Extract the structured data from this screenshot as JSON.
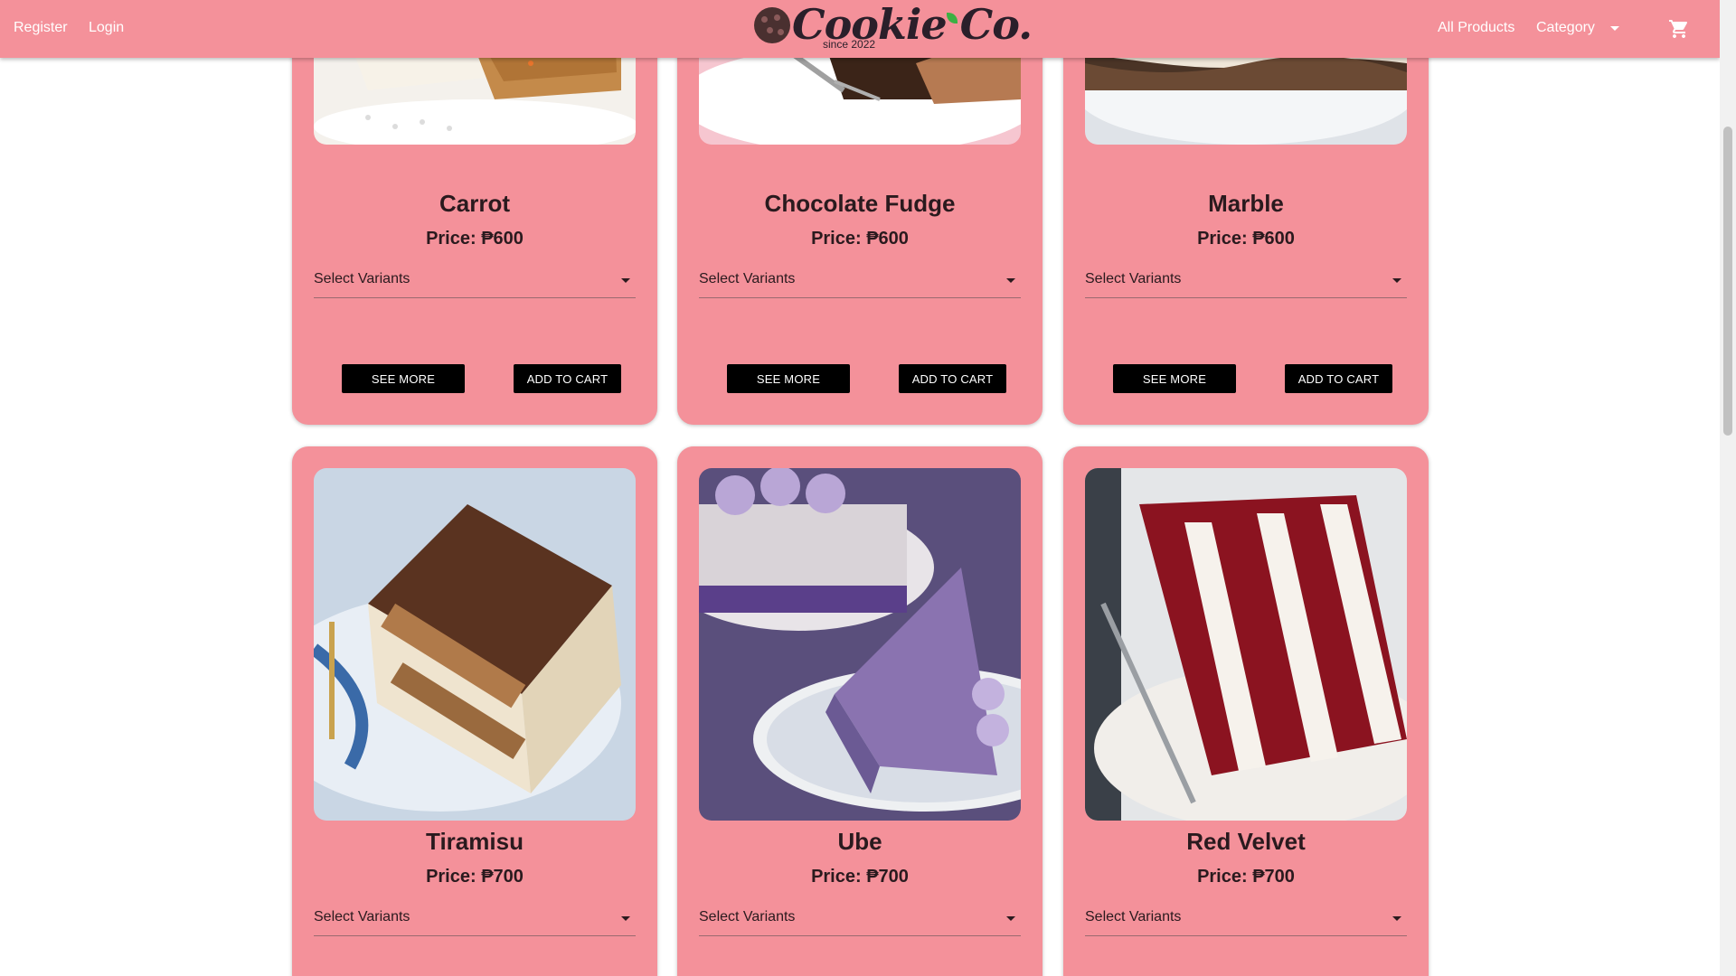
{
  "nav": {
    "register": "Register",
    "login": "Login",
    "brand_name": "Cookie Co.",
    "brand_tagline": "since 2022",
    "all_products": "All Products",
    "category": "Category",
    "cart_icon": "shopping-cart-icon"
  },
  "products": [
    {
      "name": "Carrot",
      "price": "Price: ₱600",
      "variant_placeholder": "Select Variants",
      "see_more": "SEE MORE",
      "add_to_cart": "ADD TO CART"
    },
    {
      "name": "Chocolate Fudge",
      "price": "Price: ₱600",
      "variant_placeholder": "Select Variants",
      "see_more": "SEE MORE",
      "add_to_cart": "ADD TO CART"
    },
    {
      "name": "Marble",
      "price": "Price: ₱600",
      "variant_placeholder": "Select Variants",
      "see_more": "SEE MORE",
      "add_to_cart": "ADD TO CART"
    },
    {
      "name": "Tiramisu",
      "price": "Price: ₱700",
      "variant_placeholder": "Select Variants"
    },
    {
      "name": "Ube",
      "price": "Price: ₱700",
      "variant_placeholder": "Select Variants"
    },
    {
      "name": "Red Velvet",
      "price": "Price: ₱700",
      "variant_placeholder": "Select Variants"
    }
  ],
  "colors": {
    "navbar": "#f4919a",
    "card": "#f4919a",
    "button": "#000000"
  }
}
